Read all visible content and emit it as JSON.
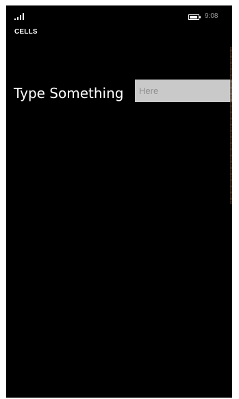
{
  "status_bar": {
    "signal_icon": "signal-strength-icon",
    "battery_icon": "battery-icon",
    "time": "9:08"
  },
  "app": {
    "title": "CELLS"
  },
  "form": {
    "label": "Type Something",
    "input_placeholder": "Here",
    "input_value": ""
  },
  "colors": {
    "background": "#000000",
    "input_background": "#c9c9c9",
    "text": "#ffffff"
  }
}
